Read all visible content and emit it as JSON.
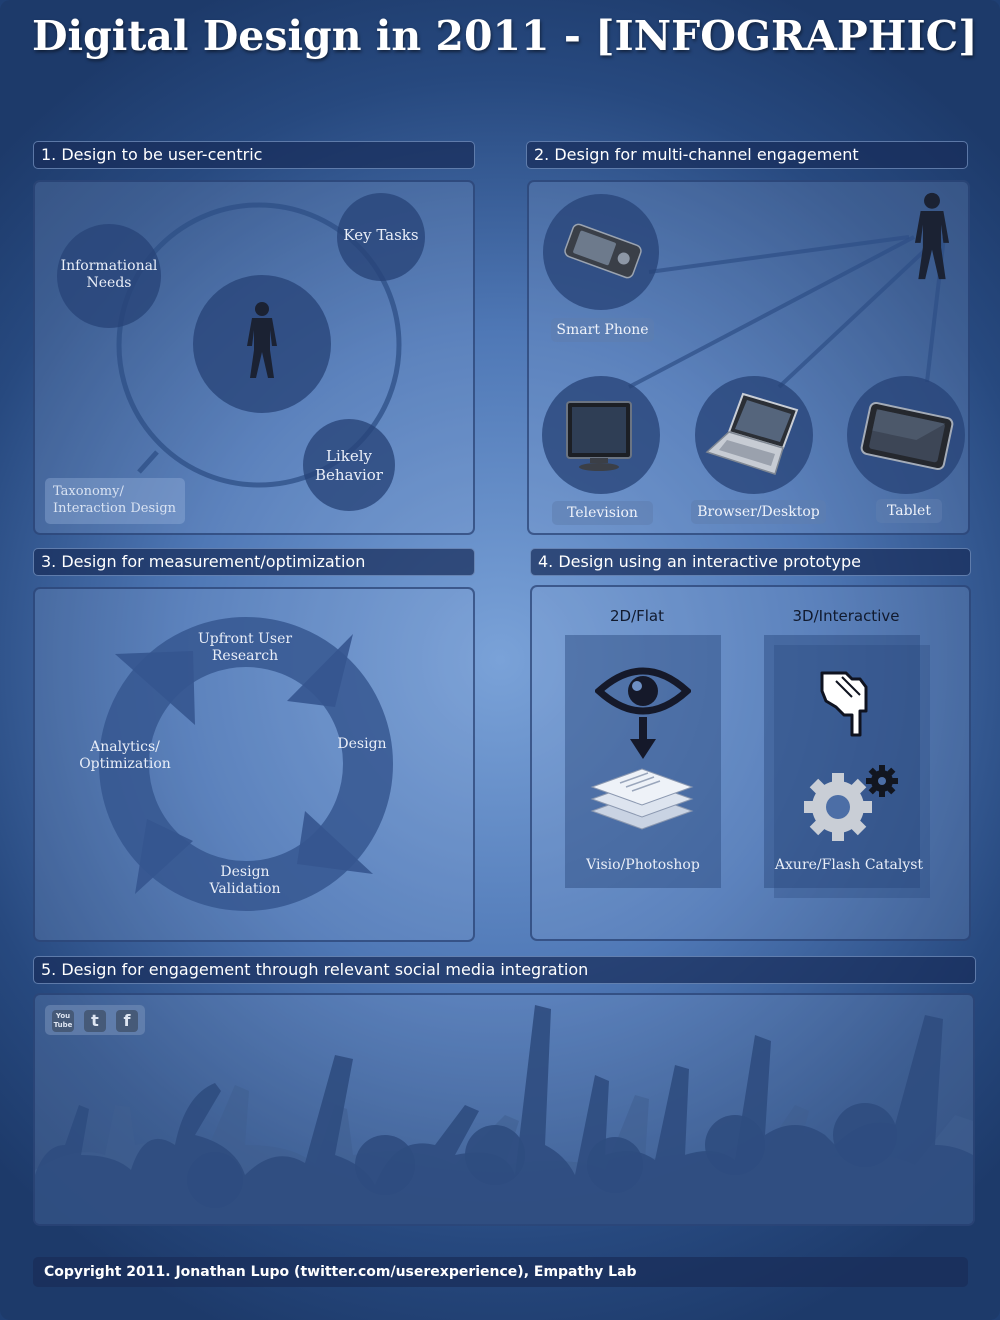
{
  "title": "Digital Design in 2011 - [INFOGRAPHIC]",
  "sections": {
    "s1": {
      "heading": "1. Design to be user-centric",
      "informational_needs": "Informational Needs",
      "key_tasks": "Key Tasks",
      "likely_behavior": "Likely Behavior",
      "taxonomy": "Taxonomy/ Interaction Design"
    },
    "s2": {
      "heading": "2. Design for multi-channel engagement",
      "smart_phone": "Smart Phone",
      "television": "Television",
      "browser_desktop": "Browser/Desktop",
      "tablet": "Tablet"
    },
    "s3": {
      "heading": "3. Design for measurement/optimization",
      "upfront": "Upfront User Research",
      "design": "Design",
      "validation": "Design Validation",
      "analytics": "Analytics/ Optimization"
    },
    "s4": {
      "heading": "4. Design using an interactive prototype",
      "col_2d": "2D/Flat",
      "col_3d": "3D/Interactive",
      "tool_2d": "Visio/Photoshop",
      "tool_3d": "Axure/Flash Catalyst"
    },
    "s5": {
      "heading": "5. Design for engagement through relevant social media integration",
      "youtube_label": "You Tube",
      "twitter_glyph": "t",
      "facebook_glyph": "f"
    }
  },
  "icons": [
    "person-icon",
    "smartphone-icon",
    "television-icon",
    "laptop-icon",
    "tablet-icon",
    "eye-icon",
    "arrow-down-icon",
    "documents-icon",
    "pointer-hand-icon",
    "gear-icon",
    "youtube-icon",
    "twitter-icon",
    "facebook-icon",
    "crowd-silhouette"
  ],
  "colors": {
    "background": "#4f78b6",
    "panel_header": "#1f3a6e",
    "circle": "#2d4b82",
    "text": "#ffffff"
  },
  "copyright": "Copyright 2011. Jonathan Lupo (twitter.com/userexperience), Empathy Lab"
}
